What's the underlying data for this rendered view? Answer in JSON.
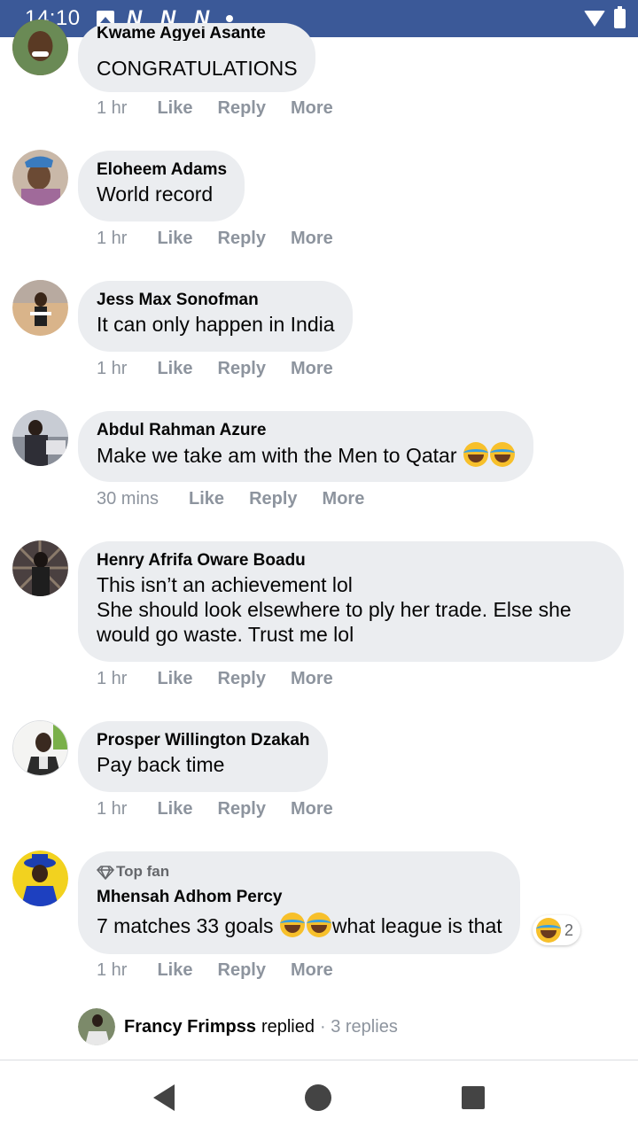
{
  "status_bar": {
    "time": "14:10",
    "notification_letters": [
      "N",
      "N",
      "N"
    ]
  },
  "comments": [
    {
      "author": "Kwame Agyei Asante",
      "lines": [
        "CONGRATULATIONS"
      ],
      "time": "1 hr",
      "avatar_color": "#7a5a3a"
    },
    {
      "author": "Eloheem Adams",
      "lines": [
        "World record"
      ],
      "time": "1 hr",
      "avatar_color": "#8a6d5a"
    },
    {
      "author": "Jess Max Sonofman",
      "lines": [
        "It can only happen in India"
      ],
      "time": "1 hr",
      "avatar_color": "#b08060"
    },
    {
      "author": "Abdul Rahman Azure",
      "lines": [
        "Make we take am with the Men to Qatar"
      ],
      "emoji_count": 2,
      "time": "30 mins",
      "avatar_color": "#3a3a44"
    },
    {
      "author": "Henry Afrifa Oware Boadu",
      "lines": [
        "This isn’t an achievement lol",
        "She should look elsewhere to ply her trade. Else she",
        "would go waste. Trust me lol"
      ],
      "time": "1 hr",
      "avatar_color": "#2a2a2a"
    },
    {
      "author": "Prosper Willington Dzakah",
      "lines": [
        "Pay back time"
      ],
      "time": "1 hr",
      "avatar_color": "#e8e8e8"
    },
    {
      "badge": "Top fan",
      "author": "Mhensah Adhom Percy",
      "text_before": "7 matches 33 goals ",
      "text_after": "what league is that",
      "reaction_count": "2",
      "time": "1 hr",
      "avatar_color": "#f2d21f"
    }
  ],
  "actions": {
    "like": "Like",
    "reply": "Reply",
    "more": "More"
  },
  "replies_row": {
    "name": "Francy Frimpss",
    "verb": "replied",
    "count": "· 3 replies"
  },
  "colors": {
    "status_bar": "#3b5998",
    "bubble": "#ebedf0",
    "muted": "#8d949e"
  }
}
